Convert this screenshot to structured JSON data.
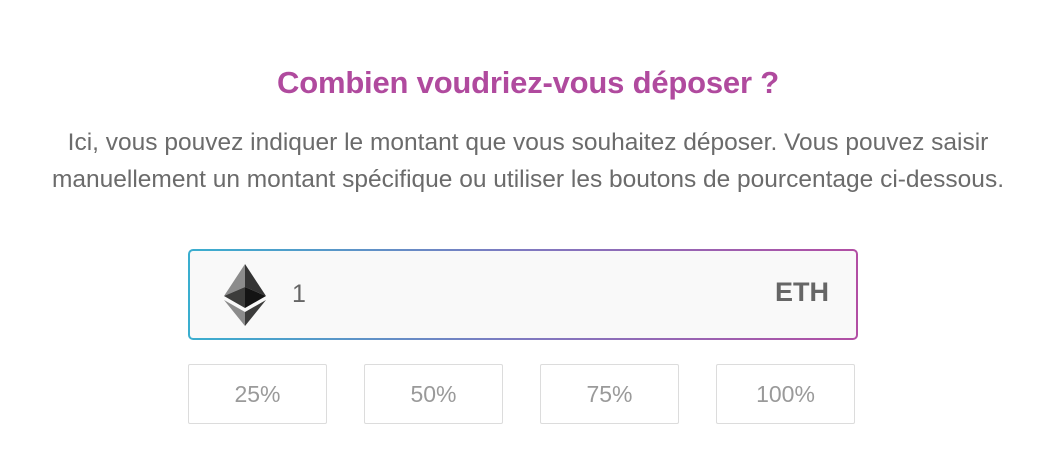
{
  "deposit": {
    "title": "Combien voudriez-vous déposer ?",
    "description": "Ici, vous pouvez indiquer le montant que vous souhaitez déposer. Vous pouvez saisir manuellement un montant spécifique ou utiliser les boutons de pourcentage ci-dessous.",
    "amount": {
      "value": "1",
      "currency": "ETH",
      "icon": "ethereum-icon"
    },
    "percent_buttons": [
      "25%",
      "50%",
      "75%",
      "100%"
    ]
  },
  "colors": {
    "title": "#b04a9e",
    "text": "#6b6b6b",
    "gradient_start": "#3aaecf",
    "gradient_end": "#b24ea4",
    "button_border": "#dcdcdc",
    "button_text": "#9a9a9a"
  }
}
